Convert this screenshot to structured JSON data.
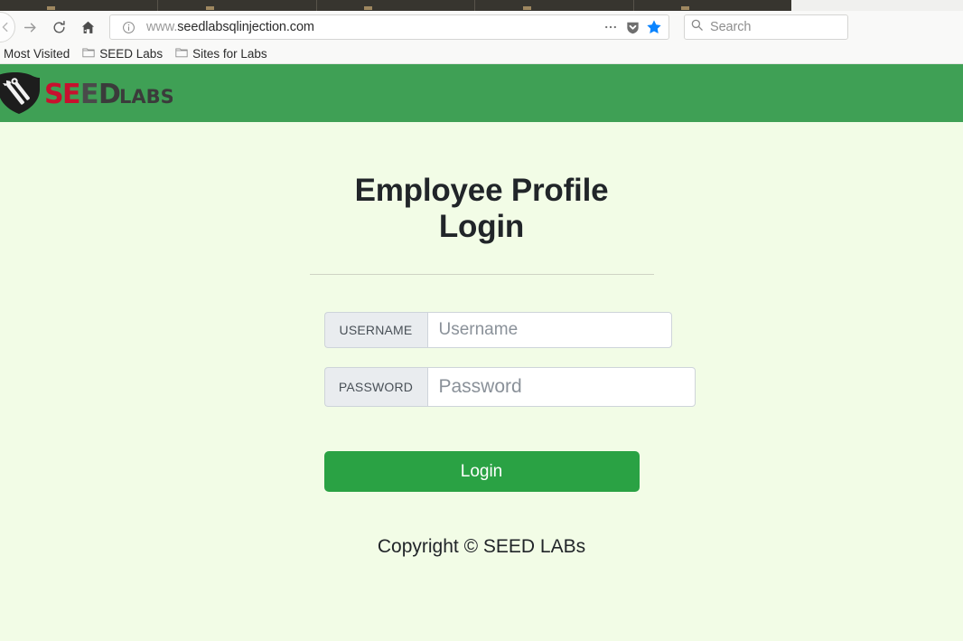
{
  "browser": {
    "nav": {
      "back_icon": "arrow-left-icon",
      "forward_icon": "arrow-right-icon",
      "reload_icon": "reload-icon",
      "home_icon": "home-icon"
    },
    "url_bar": {
      "info_icon": "info-circle-icon",
      "scheme": "www.",
      "host": "seedlabsqlinjection.com",
      "page_actions_icon": "ellipsis-icon",
      "pocket_icon": "pocket-shield-icon",
      "bookmark_icon": "star-filled-icon",
      "bookmark_color": "#0a84ff"
    },
    "search": {
      "icon": "search-icon",
      "placeholder": "Search"
    },
    "bookmarks": [
      {
        "label": "Most Visited",
        "icon": "none"
      },
      {
        "label": "SEED Labs",
        "icon": "folder-icon"
      },
      {
        "label": "Sites for Labs",
        "icon": "folder-icon"
      }
    ]
  },
  "site": {
    "header": {
      "background": "#3fa055",
      "logo_text_primary": "SEED",
      "logo_text_secondary": "LABS",
      "logo_icon": "shield-tools-icon"
    },
    "background": "#f2fce6",
    "title": "Employee Profile Login",
    "form": {
      "username": {
        "label": "USERNAME",
        "placeholder": "Username",
        "value": ""
      },
      "password": {
        "label": "PASSWORD",
        "placeholder": "Password",
        "value": ""
      },
      "submit_label": "Login",
      "submit_color": "#2aa244"
    },
    "footer": "Copyright © SEED LABs"
  }
}
